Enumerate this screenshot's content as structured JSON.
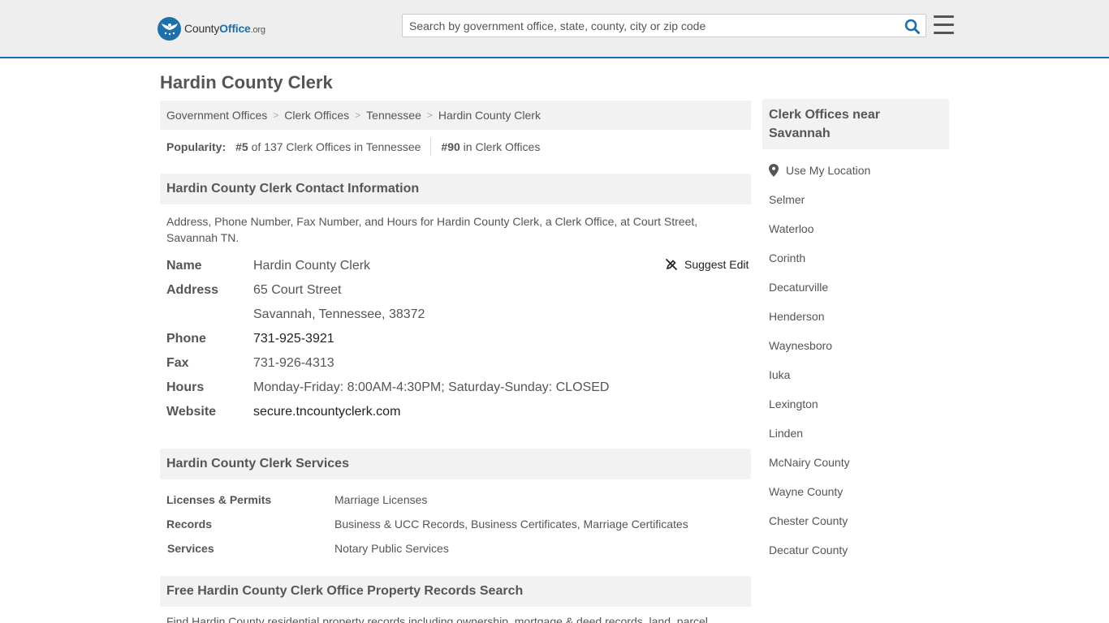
{
  "header": {
    "logo": {
      "brand_a": "County",
      "brand_b": "Office",
      "tld": ".org"
    },
    "search_placeholder": "Search by government office, state, county, city or zip code"
  },
  "page_title": "Hardin County Clerk",
  "breadcrumb": [
    "Government Offices",
    "Clerk Offices",
    "Tennessee",
    "Hardin County Clerk"
  ],
  "popularity": {
    "label": "Popularity:",
    "state_rank": "#5",
    "state_text": "of 137 Clerk Offices in Tennessee",
    "national_rank": "#90",
    "national_text": "in Clerk Offices"
  },
  "contact": {
    "heading": "Hardin County Clerk Contact Information",
    "description": "Address, Phone Number, Fax Number, and Hours for Hardin County Clerk, a Clerk Office, at Court Street, Savannah TN.",
    "suggest_edit": "Suggest Edit",
    "rows": [
      {
        "label": "Name",
        "value": "Hardin County Clerk"
      },
      {
        "label": "Address",
        "value": "65 Court Street"
      },
      {
        "label": "",
        "value": "Savannah, Tennessee, 38372"
      },
      {
        "label": "Phone",
        "value": "731-925-3921"
      },
      {
        "label": "Fax",
        "value": "731-926-4313"
      },
      {
        "label": "Hours",
        "value": "Monday-Friday: 8:00AM-4:30PM; Saturday-Sunday: CLOSED"
      },
      {
        "label": "Website",
        "value": "secure.tncountyclerk.com"
      }
    ]
  },
  "services": {
    "heading": "Hardin County Clerk Services",
    "rows": [
      {
        "label": "Licenses & Permits",
        "value": "Marriage Licenses"
      },
      {
        "label": "Records",
        "value": "Business & UCC Records, Business Certificates, Marriage Certificates"
      },
      {
        "label": "Services",
        "value": "Notary Public Services"
      }
    ]
  },
  "property": {
    "heading": "Free Hardin County Clerk Office Property Records Search",
    "text": "Find Hardin County residential property records including ownership, mortgage & deed records, land, parcel"
  },
  "sidebar": {
    "heading": "Clerk Offices near Savannah",
    "use_location": "Use My Location",
    "cities": [
      "Selmer",
      "Waterloo",
      "Corinth",
      "Decaturville",
      "Henderson",
      "Waynesboro",
      "Iuka",
      "Lexington",
      "Linden",
      "McNairy County",
      "Wayne County",
      "Chester County",
      "Decatur County"
    ]
  },
  "colors": {
    "brand_blue": "#1f6fa8",
    "panel_gray": "#f2f2f2",
    "text_gray": "#555555"
  }
}
